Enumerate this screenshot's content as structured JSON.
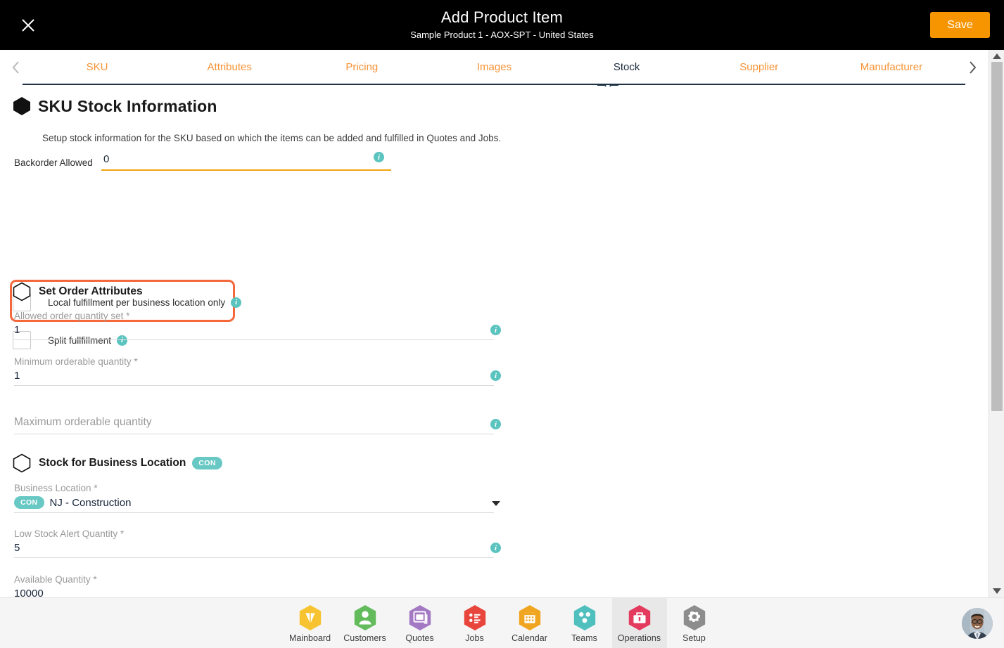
{
  "titlebar": {
    "close_icon": "close-icon",
    "title": "Add Product Item",
    "subtitle": "Sample Product 1 - AOX-SPT - United States",
    "save_label": "Save",
    "save_color": "#f79500",
    "background": "#000000"
  },
  "tabs": {
    "prev_icon": "chevron-left-icon",
    "next_icon": "chevron-right-icon",
    "active": "Stock",
    "items": [
      {
        "label": "SKU"
      },
      {
        "label": "Attributes"
      },
      {
        "label": "Pricing"
      },
      {
        "label": "Images"
      },
      {
        "label": "Stock"
      },
      {
        "label": "Supplier"
      },
      {
        "label": "Manufacturer"
      }
    ],
    "inactive_color": "#f79234",
    "active_color": "#203040"
  },
  "main": {
    "section_title": "SKU Stock Information",
    "section_desc": "Setup stock information for the SKU based on which the items can be added and fulfilled in Quotes and Jobs.",
    "backorder": {
      "label": "Backorder Allowed",
      "value": "0",
      "info_icon": "info-icon",
      "underline_color": "#f2a30f"
    },
    "checkboxes": [
      {
        "label": "Local fulfillment per business location only",
        "checked": false,
        "info_icon": "info-icon",
        "highlighted": true
      },
      {
        "label": "Split fullfillment",
        "checked": false,
        "info_icon": "info-icon",
        "highlighted": false
      }
    ],
    "highlight_color": "#f4683c",
    "order_attributes": {
      "title": "Set Order Attributes",
      "fields": [
        {
          "label": "Allowed order quantity set *",
          "value": "1",
          "info_icon": "info-icon"
        },
        {
          "label": "Minimum orderable quantity *",
          "value": "1",
          "info_icon": "info-icon"
        },
        {
          "label": "Maximum orderable quantity",
          "value": "",
          "placeholder": "Maximum orderable quantity",
          "info_icon": "info-icon"
        }
      ]
    },
    "stock_location": {
      "title": "Stock for Business Location",
      "badge": "CON",
      "badge_color": "#68c8c4",
      "business_location": {
        "label": "Business Location *",
        "badge": "CON",
        "value": "NJ - Construction",
        "caret_icon": "chevron-down-icon"
      },
      "low_stock": {
        "label": "Low Stock Alert Quantity *",
        "value": "5",
        "info_icon": "info-icon"
      },
      "available": {
        "label": "Available Quantity *",
        "value": "10000"
      }
    }
  },
  "scrollbar": {
    "up_icon": "scroll-up-arrow-icon",
    "down_icon": "scroll-down-arrow-icon"
  },
  "bottomnav": {
    "items": [
      {
        "label": "Mainboard",
        "icon": "mainboard-icon",
        "color": "#f7c331",
        "active": false
      },
      {
        "label": "Customers",
        "icon": "customers-icon",
        "color": "#63bb5c",
        "active": false
      },
      {
        "label": "Quotes",
        "icon": "quotes-icon",
        "color": "#a479c4",
        "active": false
      },
      {
        "label": "Jobs",
        "icon": "jobs-icon",
        "color": "#e8453c",
        "active": false
      },
      {
        "label": "Calendar",
        "icon": "calendar-icon",
        "color": "#f0a520",
        "active": false
      },
      {
        "label": "Teams",
        "icon": "teams-icon",
        "color": "#4fc0bd",
        "active": false
      },
      {
        "label": "Operations",
        "icon": "operations-icon",
        "color": "#e33a5e",
        "active": true
      },
      {
        "label": "Setup",
        "icon": "setup-icon",
        "color": "#8d8d8d",
        "active": false
      }
    ],
    "avatar": "user-avatar"
  }
}
